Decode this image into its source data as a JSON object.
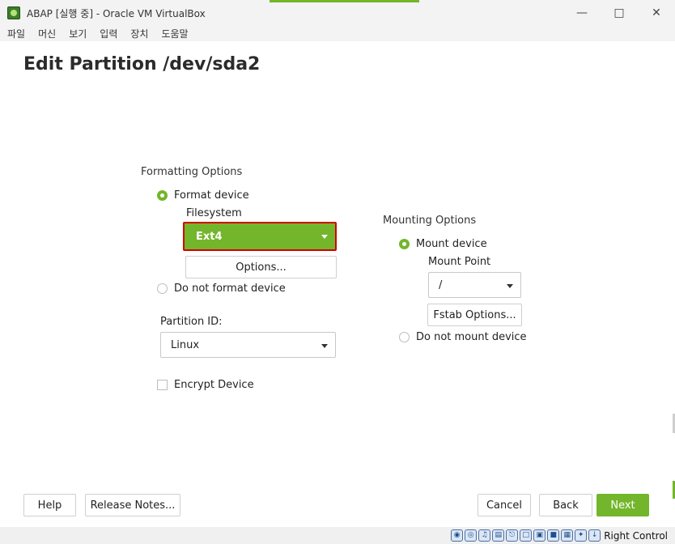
{
  "window": {
    "title": "ABAP [실행 중] - Oracle VM VirtualBox",
    "minimize_glyph": "—",
    "maximize_glyph": "□",
    "close_glyph": "✕"
  },
  "menu": [
    "파일",
    "머신",
    "보기",
    "입력",
    "장치",
    "도움말"
  ],
  "page": {
    "title": "Edit Partition /dev/sda2"
  },
  "formatting": {
    "heading": "Formatting Options",
    "format_device": "Format device",
    "filesystem_label": "Filesystem",
    "filesystem_value": "Ext4",
    "options_button": "Options...",
    "do_not_format": "Do not format device",
    "partition_id_label": "Partition ID:",
    "partition_id_value": "Linux",
    "encrypt_label": "Encrypt Device"
  },
  "mounting": {
    "heading": "Mounting Options",
    "mount_device": "Mount device",
    "mount_point_label": "Mount Point",
    "mount_point_value": "/",
    "fstab_button": "Fstab Options...",
    "do_not_mount": "Do not mount device"
  },
  "footer": {
    "help": "Help",
    "release_notes": "Release Notes...",
    "cancel": "Cancel",
    "back": "Back",
    "next": "Next"
  },
  "statusbar": {
    "host_key": "Right Control",
    "icons": [
      "hard-disk-icon",
      "optical-drive-icon",
      "audio-icon",
      "network-icon",
      "usb-icon",
      "shared-folder-icon",
      "display-icon",
      "recording-icon",
      "cpu-icon",
      "mouse-integration-icon",
      "keyboard-icon"
    ]
  },
  "colors": {
    "accent": "#73b62b",
    "highlight_border": "#d40000"
  }
}
